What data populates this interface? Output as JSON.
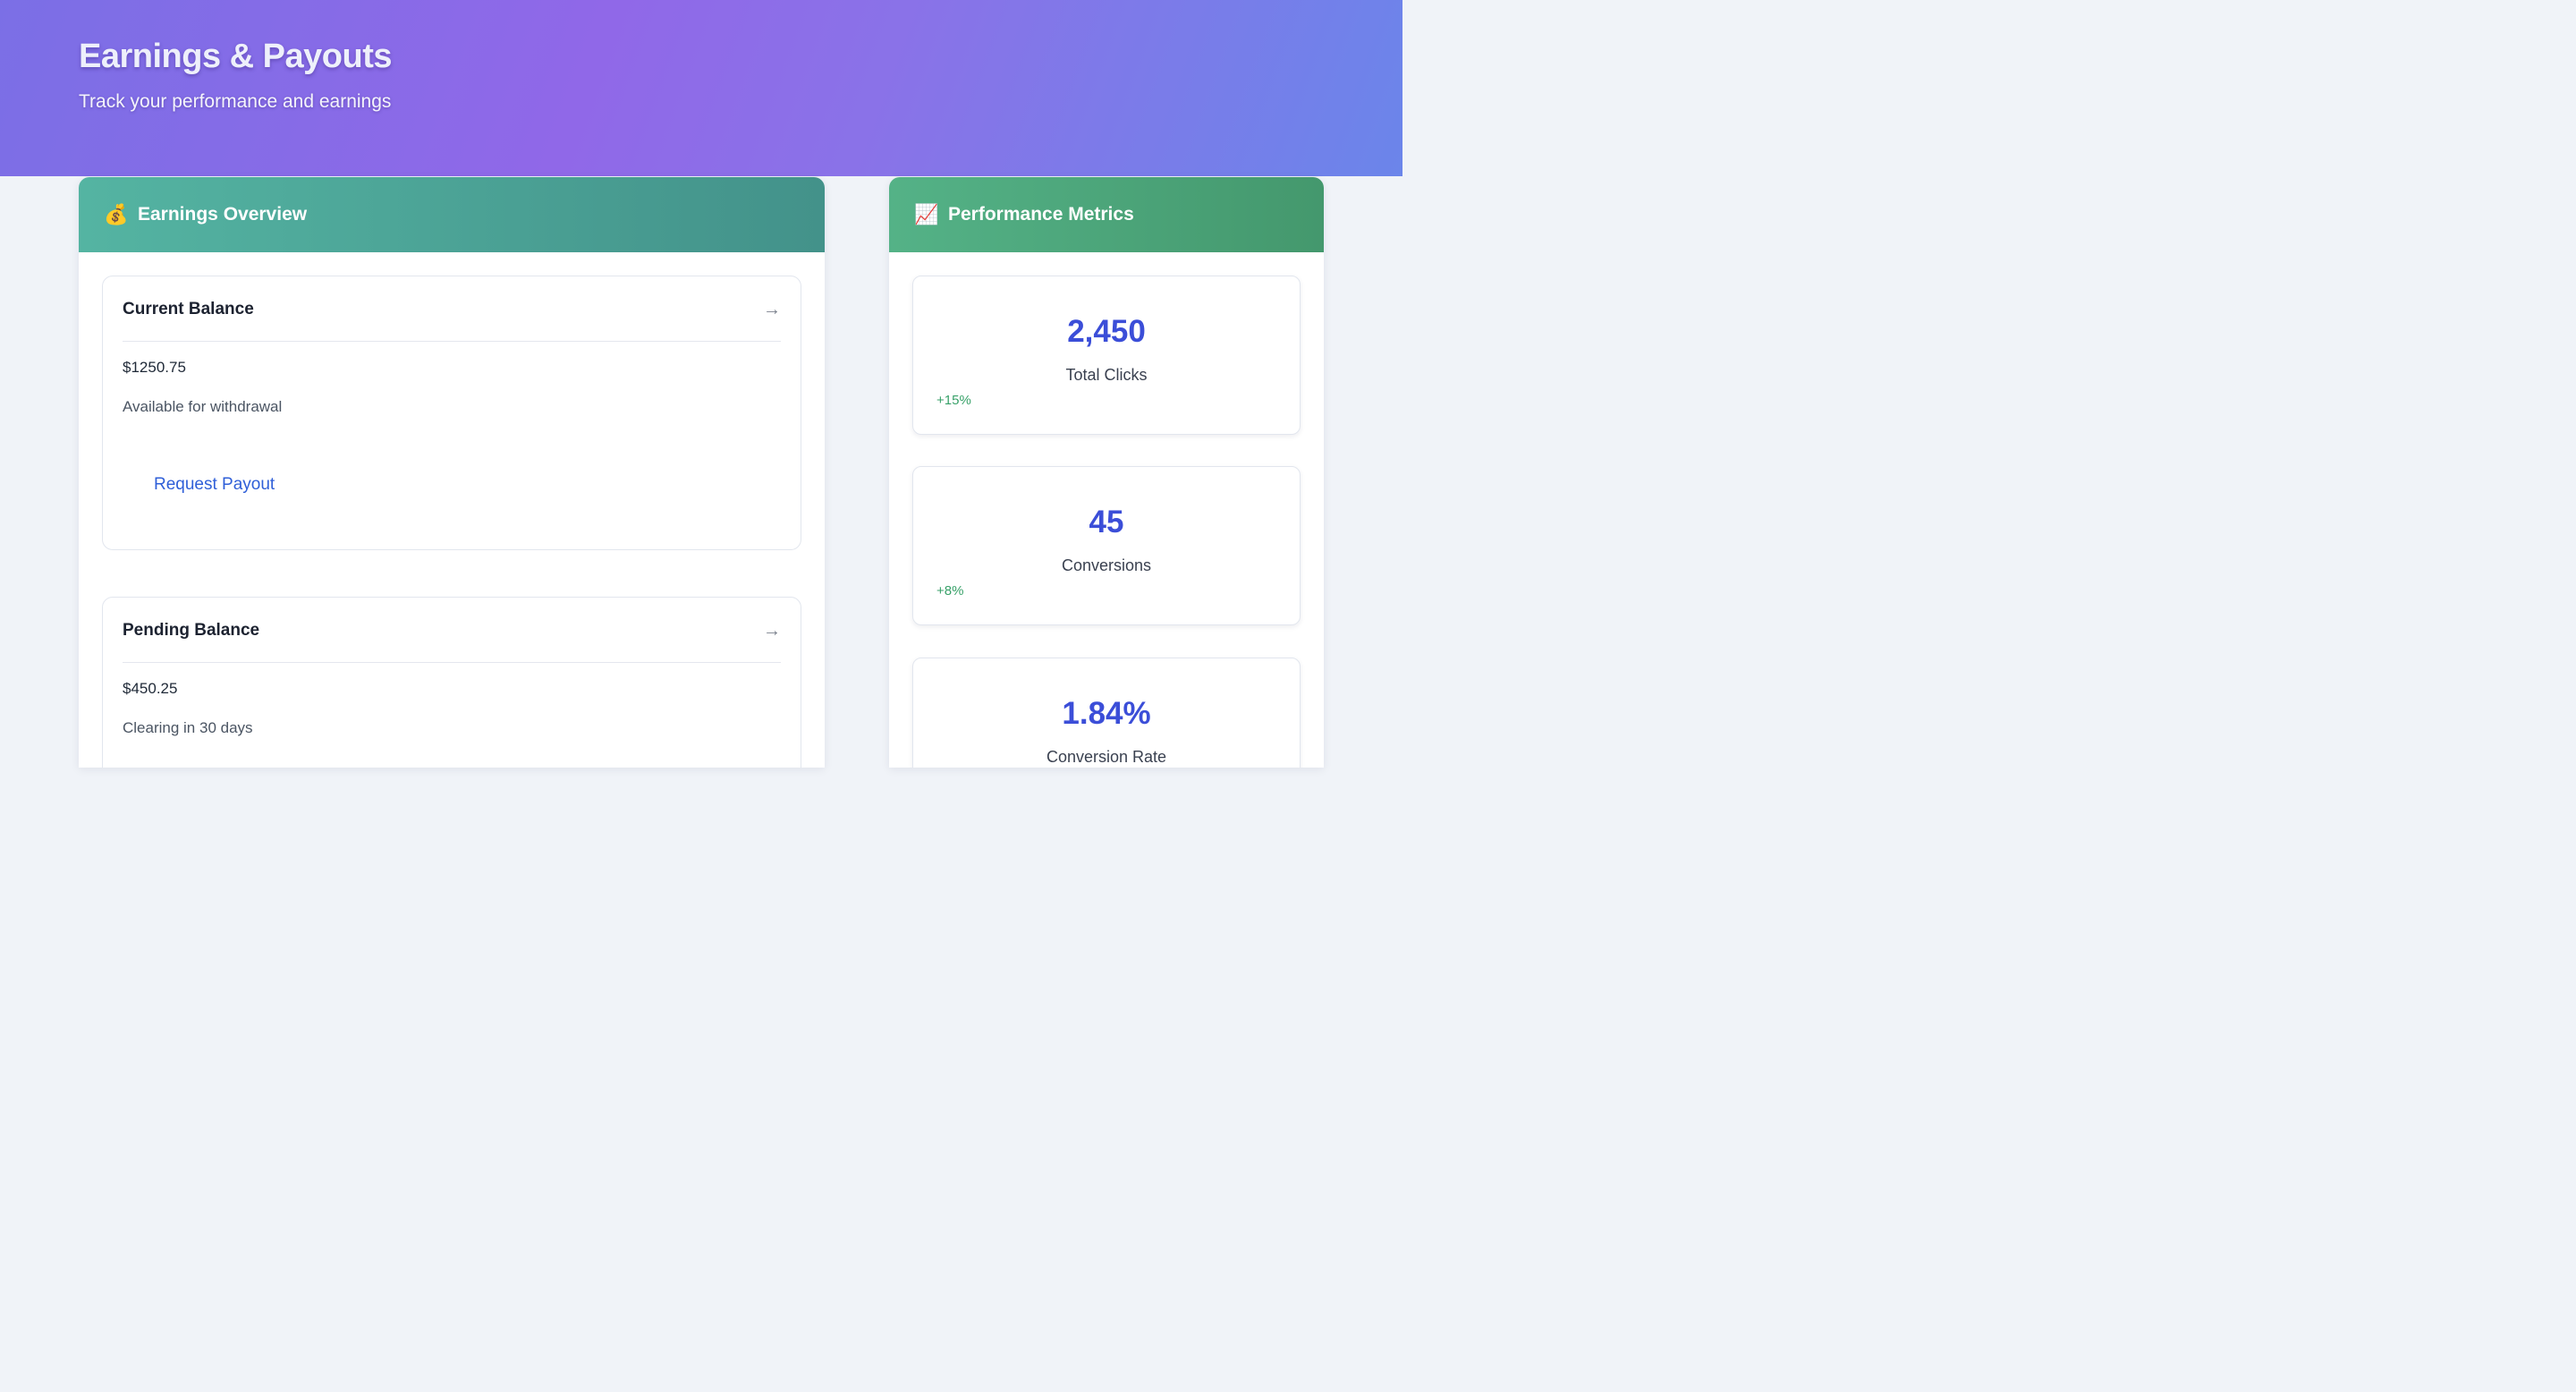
{
  "header": {
    "title": "Earnings & Payouts",
    "subtitle": "Track your performance and earnings"
  },
  "earnings_panel": {
    "icon": "money-bag-icon",
    "icon_glyph": "💰",
    "title": "Earnings Overview",
    "cards": [
      {
        "title": "Current Balance",
        "amount": "$1250.75",
        "note": "Available for withdrawal",
        "action_label": "Request Payout"
      },
      {
        "title": "Pending Balance",
        "amount": "$450.25",
        "note": "Clearing in 30 days"
      }
    ]
  },
  "metrics_panel": {
    "icon": "chart-increasing-icon",
    "icon_glyph": "📈",
    "title": "Performance Metrics",
    "metrics": [
      {
        "value": "2,450",
        "label": "Total Clicks",
        "change": "+15%"
      },
      {
        "value": "45",
        "label": "Conversions",
        "change": "+8%"
      },
      {
        "value": "1.84%",
        "label": "Conversion Rate"
      }
    ]
  },
  "colors": {
    "accent_blue": "#3b4ed8",
    "link_blue": "#2f5fd8",
    "positive_green": "#38a169",
    "earnings_header": "#4fa898",
    "metrics_header": "#4ea77b",
    "hero_purple": "#8b6de8"
  }
}
